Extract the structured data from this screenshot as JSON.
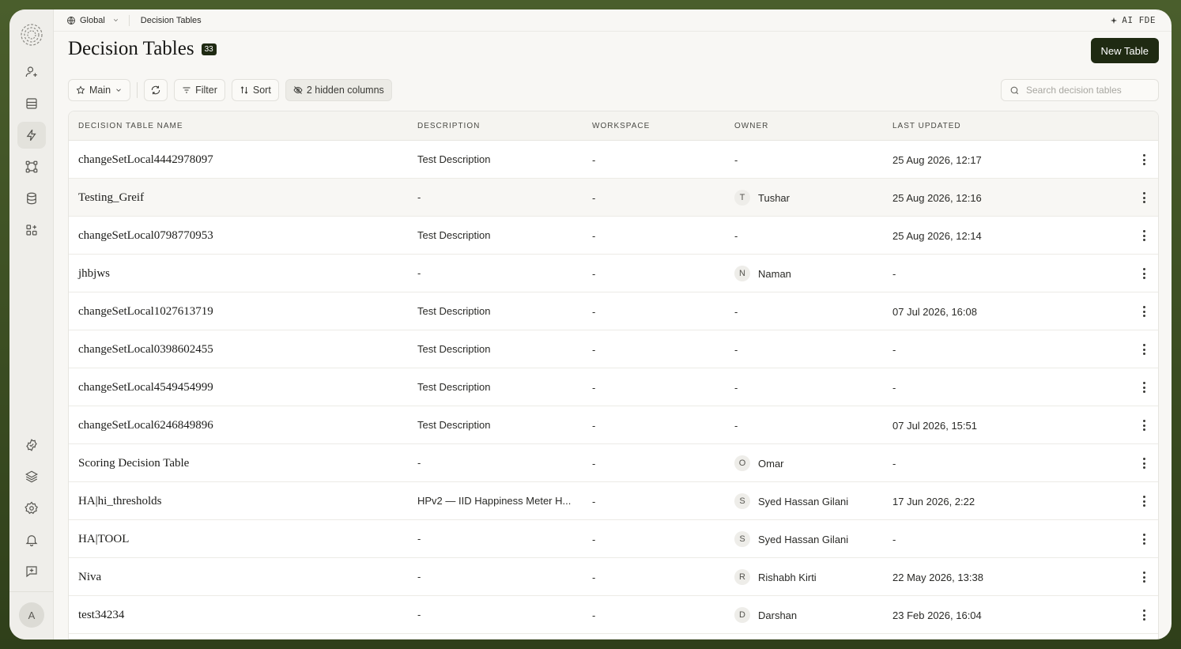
{
  "breadcrumb": {
    "scope": "Global",
    "page": "Decision Tables"
  },
  "topbar": {
    "ai_label": "AI FDE"
  },
  "header": {
    "title": "Decision Tables",
    "count": "33",
    "new_button": "New Table"
  },
  "toolbar": {
    "view_label": "Main",
    "filter_label": "Filter",
    "sort_label": "Sort",
    "hidden_columns_label": "2 hidden columns"
  },
  "search": {
    "placeholder": "Search decision tables"
  },
  "table": {
    "columns": [
      "Decision Table Name",
      "Description",
      "Workspace",
      "Owner",
      "Last Updated"
    ],
    "rows": [
      {
        "name": "changeSetLocal4442978097",
        "description": "Test Description",
        "workspace": "-",
        "owner": "-",
        "owner_initial": "",
        "last_updated": "25 Aug 2026, 12:17"
      },
      {
        "name": "Testing_Greif",
        "description": "-",
        "workspace": "-",
        "owner": "Tushar",
        "owner_initial": "T",
        "last_updated": "25 Aug 2026, 12:16"
      },
      {
        "name": "changeSetLocal0798770953",
        "description": "Test Description",
        "workspace": "-",
        "owner": "-",
        "owner_initial": "",
        "last_updated": "25 Aug 2026, 12:14"
      },
      {
        "name": "jhbjws",
        "description": "-",
        "workspace": "-",
        "owner": "Naman",
        "owner_initial": "N",
        "last_updated": "-"
      },
      {
        "name": "changeSetLocal1027613719",
        "description": "Test Description",
        "workspace": "-",
        "owner": "-",
        "owner_initial": "",
        "last_updated": "07 Jul 2026, 16:08"
      },
      {
        "name": "changeSetLocal0398602455",
        "description": "Test Description",
        "workspace": "-",
        "owner": "-",
        "owner_initial": "",
        "last_updated": "-"
      },
      {
        "name": "changeSetLocal4549454999",
        "description": "Test Description",
        "workspace": "-",
        "owner": "-",
        "owner_initial": "",
        "last_updated": "-"
      },
      {
        "name": "changeSetLocal6246849896",
        "description": "Test Description",
        "workspace": "-",
        "owner": "-",
        "owner_initial": "",
        "last_updated": "07 Jul 2026, 15:51"
      },
      {
        "name": "Scoring Decision Table",
        "description": "-",
        "workspace": "-",
        "owner": "Omar",
        "owner_initial": "O",
        "last_updated": "-"
      },
      {
        "name": "HA|hi_thresholds",
        "description": "HPv2 — IID Happiness Meter H...",
        "workspace": "-",
        "owner": "Syed Hassan Gilani",
        "owner_initial": "S",
        "last_updated": "17 Jun 2026, 2:22"
      },
      {
        "name": "HA|TOOL",
        "description": "-",
        "workspace": "-",
        "owner": "Syed Hassan Gilani",
        "owner_initial": "S",
        "last_updated": "-"
      },
      {
        "name": "Niva",
        "description": "-",
        "workspace": "-",
        "owner": "Rishabh Kirti",
        "owner_initial": "R",
        "last_updated": "22 May 2026, 13:38"
      },
      {
        "name": "test34234",
        "description": "-",
        "workspace": "-",
        "owner": "Darshan",
        "owner_initial": "D",
        "last_updated": "23 Feb 2026, 16:04"
      }
    ]
  },
  "user": {
    "initial": "A"
  },
  "colors": {
    "accent": "#1f2a12",
    "frame": "#3b4d22",
    "background": "#f8f7f4"
  }
}
